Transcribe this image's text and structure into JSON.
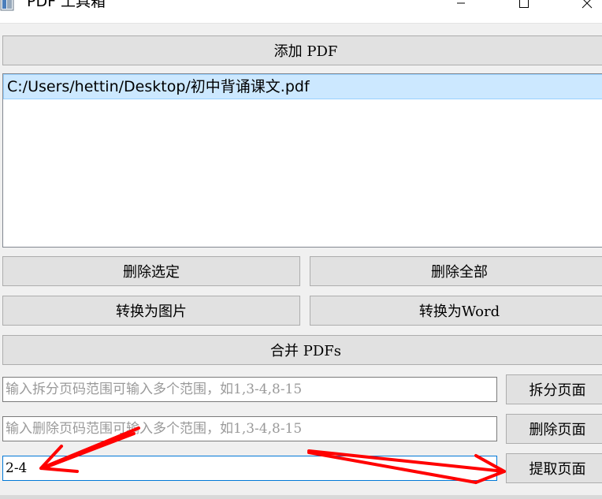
{
  "window": {
    "title": "PDF 工具箱"
  },
  "buttons": {
    "add_pdf": "添加 PDF",
    "delete_selected": "删除选定",
    "delete_all": "删除全部",
    "to_image": "转换为图片",
    "to_word": "转换为Word",
    "merge": "合并 PDFs",
    "split_pages": "拆分页面",
    "delete_pages": "删除页面",
    "extract_pages": "提取页面"
  },
  "file_list": {
    "items": [
      "C:/Users/hettin/Desktop/初中背诵课文.pdf"
    ]
  },
  "inputs": {
    "split_placeholder": "输入拆分页码范围可输入多个范围，如1,3-4,8-15",
    "delete_placeholder": "输入删除页码范围可输入多个范围，如1,3-4,8-15",
    "extract_value": "2-4"
  },
  "colors": {
    "annotation_arrow": "#ff0000",
    "selection": "#cce8ff",
    "focus_border": "#0078d7"
  }
}
